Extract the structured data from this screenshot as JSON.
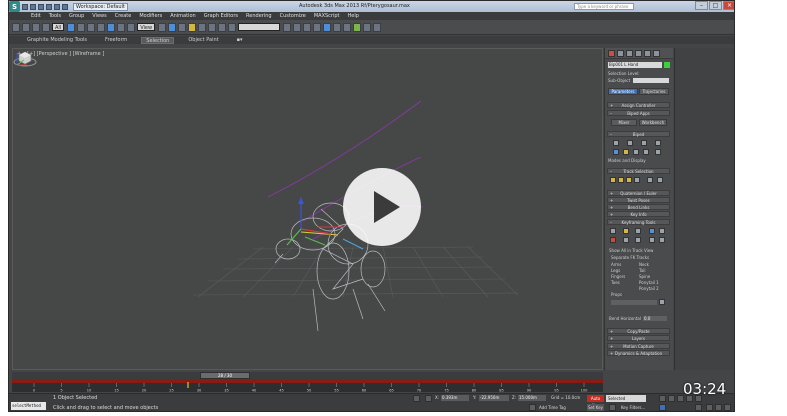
{
  "titlebar": {
    "logo": "S",
    "workspace": "Workspace: Default",
    "window_title": "Autodesk 3ds Max  2013     Rf/Pterygosaur.max",
    "help_search_placeholder": "Type a keyword or phrase",
    "window_buttons": [
      "–",
      "□",
      "×"
    ]
  },
  "menu": [
    "Edit",
    "Tools",
    "Group",
    "Views",
    "Create",
    "Modifiers",
    "Animation",
    "Graph Editors",
    "Rendering",
    "Customize",
    "MAXScript",
    "Help"
  ],
  "toolbar": {
    "filter_value": "All",
    "view_value": "View",
    "named_selection": ""
  },
  "ribbon": {
    "tabs": [
      "Graphite Modeling Tools",
      "Freeform",
      "Selection",
      "Object Paint"
    ],
    "active": "Selection"
  },
  "viewport": {
    "label": "[+] [Perspective ] [Wireframe ]",
    "plus": "+",
    "play_button": "play-icon"
  },
  "command_panel": {
    "object_name": "Bip001 L Hand",
    "object_color": "#3bd13b",
    "selection_level_label": "Selection Level:",
    "sub_object_label": "Sub-Object",
    "mode_buttons": [
      "Parameters",
      "Trajectories"
    ],
    "rollouts": {
      "assign_controller": "Assign Controller",
      "biped_apps": "Biped Apps",
      "mixer": "Mixer",
      "workbench": "Workbench",
      "biped": "Biped",
      "modes_display": "Modes and Display",
      "track_selection": "Track Selection",
      "quaternion": "Quaternion / Euler",
      "twist_poses": "Twist Poses",
      "bend_links": "Bend Links",
      "key_info": "Key Info",
      "keyframing_tools": "Keyframing Tools",
      "show_all_track_view": "Show All in Track View",
      "separate_fk_tracks": "Separate FK Tracks",
      "copy_paste": "Copy/Paste",
      "layers": "Layers",
      "motion_capture": "Motion Capture",
      "dynamics": "Dynamics & Adaptation"
    },
    "fk_tracks_left": [
      "Arms",
      "Legs",
      "Fingers",
      "Toes"
    ],
    "fk_tracks_right": [
      "Neck",
      "Tail",
      "Spine",
      "Ponytail 1",
      "Ponytail 2"
    ],
    "prop_label": "Props",
    "bend_horizontal_label": "Bend Horizontal",
    "bend_horizontal_value": "0.0"
  },
  "timeline": {
    "thumb": "28 / 30",
    "ticks": [
      "0",
      "5",
      "10",
      "15",
      "20",
      "25",
      "30",
      "35",
      "40",
      "45",
      "50",
      "55",
      "60",
      "65",
      "70",
      "75",
      "80",
      "85",
      "90",
      "95",
      "100"
    ],
    "current_frame": 28
  },
  "status": {
    "maxscript": "selectMethod",
    "line1": "1 Object Selected",
    "line2": "Click and drag to select and move objects",
    "x_label": "X:",
    "x_value": "0.393m",
    "y_label": "Y:",
    "y_value": "-22.950m",
    "z_label": "Z:",
    "z_value": "15.000m",
    "grid": "Grid = 10.0cm",
    "add_time_tag": "Add Time Tag",
    "auto_key": "Auto Key",
    "set_key": "Set Key",
    "selected": "Selected",
    "key_filters": "Key Filters..."
  },
  "overlay": {
    "timestamp": "03:24"
  },
  "colors": {
    "accent": "#4f8ed6",
    "auto_key": "#c62b1f",
    "timeline_red": "#8a1a14"
  }
}
